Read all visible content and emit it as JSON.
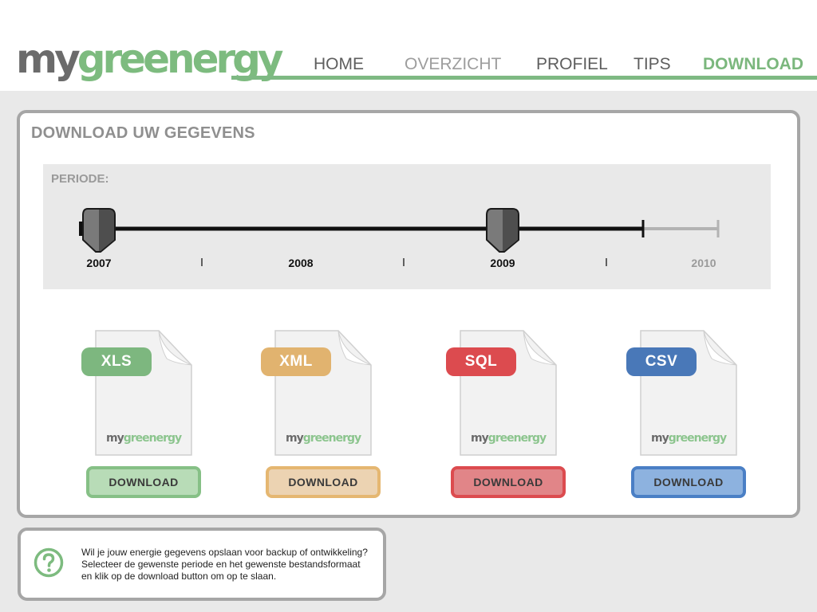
{
  "logo": {
    "part1": "my",
    "part2": "greenergy"
  },
  "nav": [
    {
      "label": "HOME"
    },
    {
      "label": "OVERZICHT"
    },
    {
      "label": "PROFIEL"
    },
    {
      "label": "TIPS"
    },
    {
      "label": "DOWNLOAD"
    }
  ],
  "nav_active": "DOWNLOAD",
  "panel": {
    "title": "DOWNLOAD UW GEGEVENS",
    "period_label": "PERIODE:",
    "years": [
      "2007",
      "2008",
      "2009",
      "2010"
    ],
    "selected_range": {
      "start": "2007",
      "end": "2009"
    }
  },
  "files": [
    {
      "type": "XLS",
      "button_label": "DOWNLOAD",
      "color": "#7db77f",
      "button_bg": "#b8dcb7",
      "button_border": "#86c086"
    },
    {
      "type": "XML",
      "button_label": "DOWNLOAD",
      "color": "#e1b36f",
      "button_bg": "#ecd3b2",
      "button_border": "#e5b771"
    },
    {
      "type": "SQL",
      "button_label": "DOWNLOAD",
      "color": "#dc4b4f",
      "button_bg": "#e18588",
      "button_border": "#dc4b4f"
    },
    {
      "type": "CSV",
      "button_label": "DOWNLOAD",
      "color": "#4978b8",
      "button_bg": "#8db2df",
      "button_border": "#4a7fc5"
    }
  ],
  "help": {
    "icon": "question-circle-icon",
    "lines": [
      "Wil je jouw energie gegevens opslaan voor backup of ontwikkeling?",
      "Selecteer de gewenste periode en het gewenste bestandsformaat",
      "en klik op de download button om op te slaan."
    ]
  }
}
